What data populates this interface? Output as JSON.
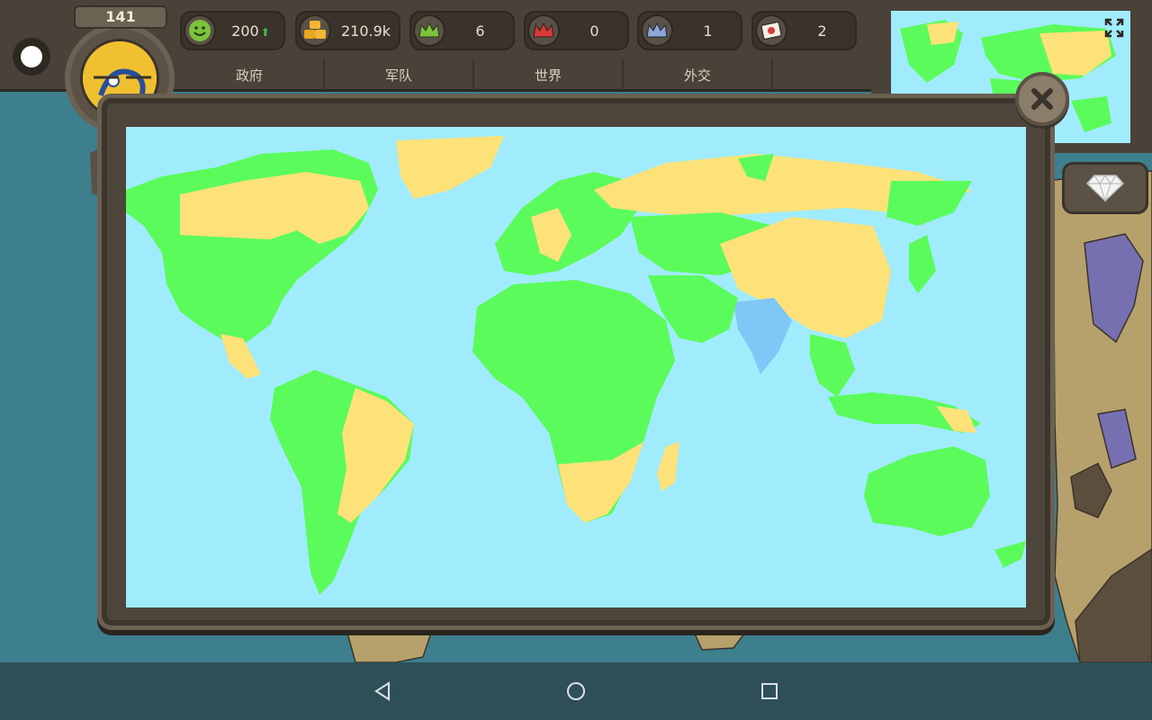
{
  "header": {
    "level": "141",
    "stats": [
      {
        "icon": "smiley-face-icon",
        "value": "200",
        "trend": "up"
      },
      {
        "icon": "gold-coins-icon",
        "value": "210.9k",
        "trend": "up"
      },
      {
        "icon": "green-crown-icon",
        "value": "6"
      },
      {
        "icon": "red-crown-icon",
        "value": "0"
      },
      {
        "icon": "blue-crown-icon",
        "value": "1"
      },
      {
        "icon": "flag-scroll-icon",
        "value": "2"
      }
    ],
    "menu_tabs": [
      "政府",
      "军队",
      "世界",
      "外交"
    ]
  },
  "colors": {
    "ocean": "#a0ecfc",
    "allied_green": "#5bfb5b",
    "neutral_yellow": "#fde27a",
    "player_blue": "#7fc7f6",
    "frame_brown": "#4e463b"
  },
  "icons": {
    "close": "close-x-icon",
    "expand": "fullscreen-expand-icon",
    "side": "diamond-icon",
    "nav": [
      "nav-back-icon",
      "nav-home-icon",
      "nav-recents-icon"
    ]
  }
}
